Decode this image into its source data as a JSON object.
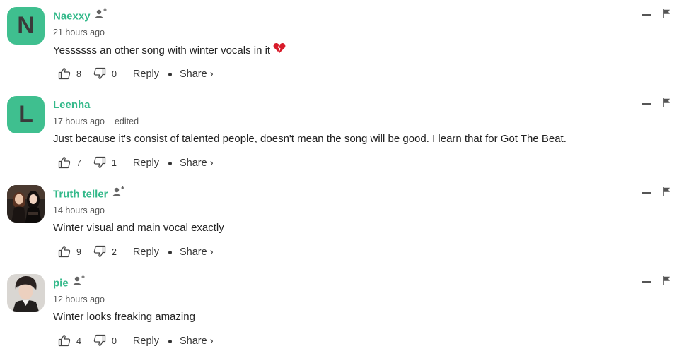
{
  "comments": [
    {
      "avatar_letter": "N",
      "avatar_color": "#3fbf8f",
      "username": "Naexxy",
      "time": "21 hours ago",
      "edited": "",
      "body": "Yessssss an other song with winter vocals in it",
      "emoji": "broken-heart-icon",
      "likes": "8",
      "dislikes": "0",
      "reply_label": "Reply",
      "share_label": "Share ›"
    },
    {
      "avatar_letter": "L",
      "avatar_color": "#3fbf8f",
      "username": "Leenha",
      "time": "17 hours ago",
      "edited": "edited",
      "body": "Just because it's consist of talented people, doesn't mean the song will be good. I learn that for Got The Beat.",
      "likes": "7",
      "dislikes": "1",
      "reply_label": "Reply",
      "share_label": "Share ›"
    },
    {
      "avatar_image": "avatar-photo-two-people",
      "username": "Truth teller",
      "time": "14 hours ago",
      "edited": "",
      "body": "Winter visual and main vocal exactly",
      "likes": "9",
      "dislikes": "2",
      "reply_label": "Reply",
      "share_label": "Share ›"
    },
    {
      "avatar_image": "avatar-photo-person",
      "username": "pie",
      "time": "12 hours ago",
      "edited": "",
      "body": "Winter looks freaking amazing",
      "likes": "4",
      "dislikes": "0",
      "reply_label": "Reply",
      "share_label": "Share ›"
    }
  ],
  "colors": {
    "accent": "#33b98a",
    "avatar_bg": "#3fbf8f",
    "text": "#222222",
    "muted": "#555555"
  }
}
